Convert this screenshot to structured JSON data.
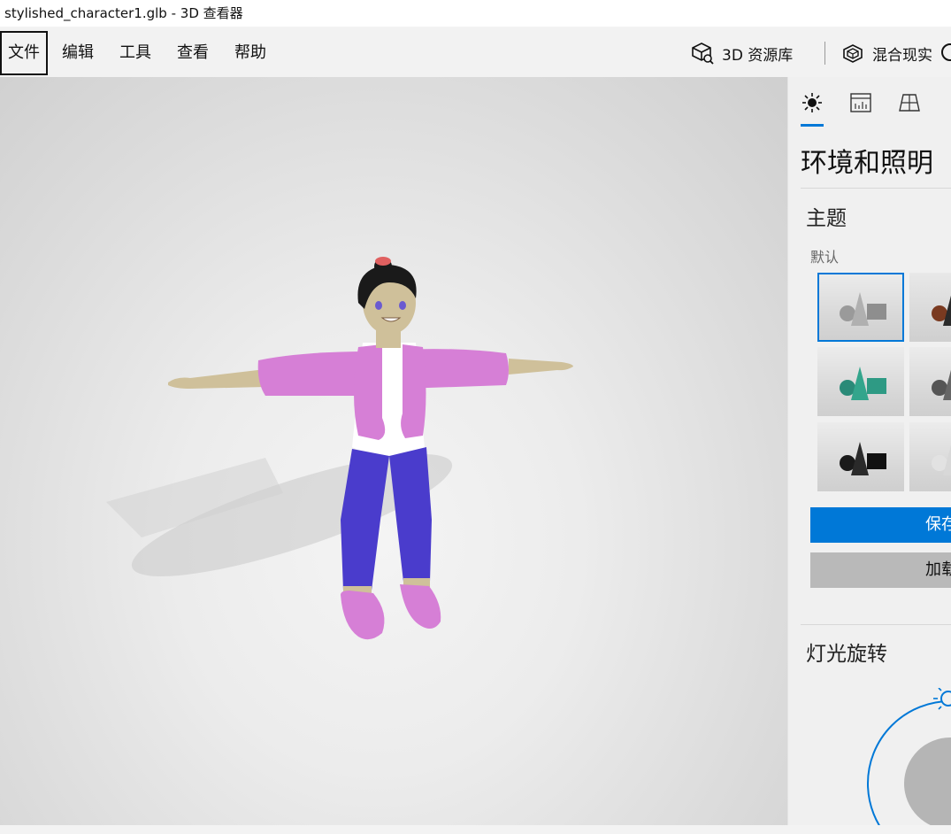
{
  "window": {
    "title": "stylished_character1.glb - 3D 查看器"
  },
  "menu": {
    "file": "文件",
    "edit": "编辑",
    "tools": "工具",
    "view": "查看",
    "help": "帮助",
    "library": "3D 资源库",
    "mixed_reality": "混合现实"
  },
  "panel": {
    "tabs": [
      {
        "icon": "sun-icon"
      },
      {
        "icon": "stats-icon"
      },
      {
        "icon": "grid-icon"
      }
    ],
    "title": "环境和照明",
    "theme": {
      "heading": "主题",
      "default_label": "默认",
      "thumbnails": [
        {
          "name": "default-gray",
          "selected": true
        },
        {
          "name": "warm-dark",
          "selected": false
        },
        {
          "name": "teal",
          "selected": false
        },
        {
          "name": "gray-partial",
          "selected": false
        },
        {
          "name": "black",
          "selected": false
        },
        {
          "name": "white-partial",
          "selected": false
        }
      ],
      "save_label": "保存",
      "load_label": "加载"
    },
    "light_rotation": {
      "heading": "灯光旋转"
    }
  },
  "colors": {
    "accent": "#0078d7",
    "jacket": "#d67fd6",
    "pants": "#4a3ccc",
    "skin": "#cfc09a",
    "hair": "#1a1a1a"
  }
}
